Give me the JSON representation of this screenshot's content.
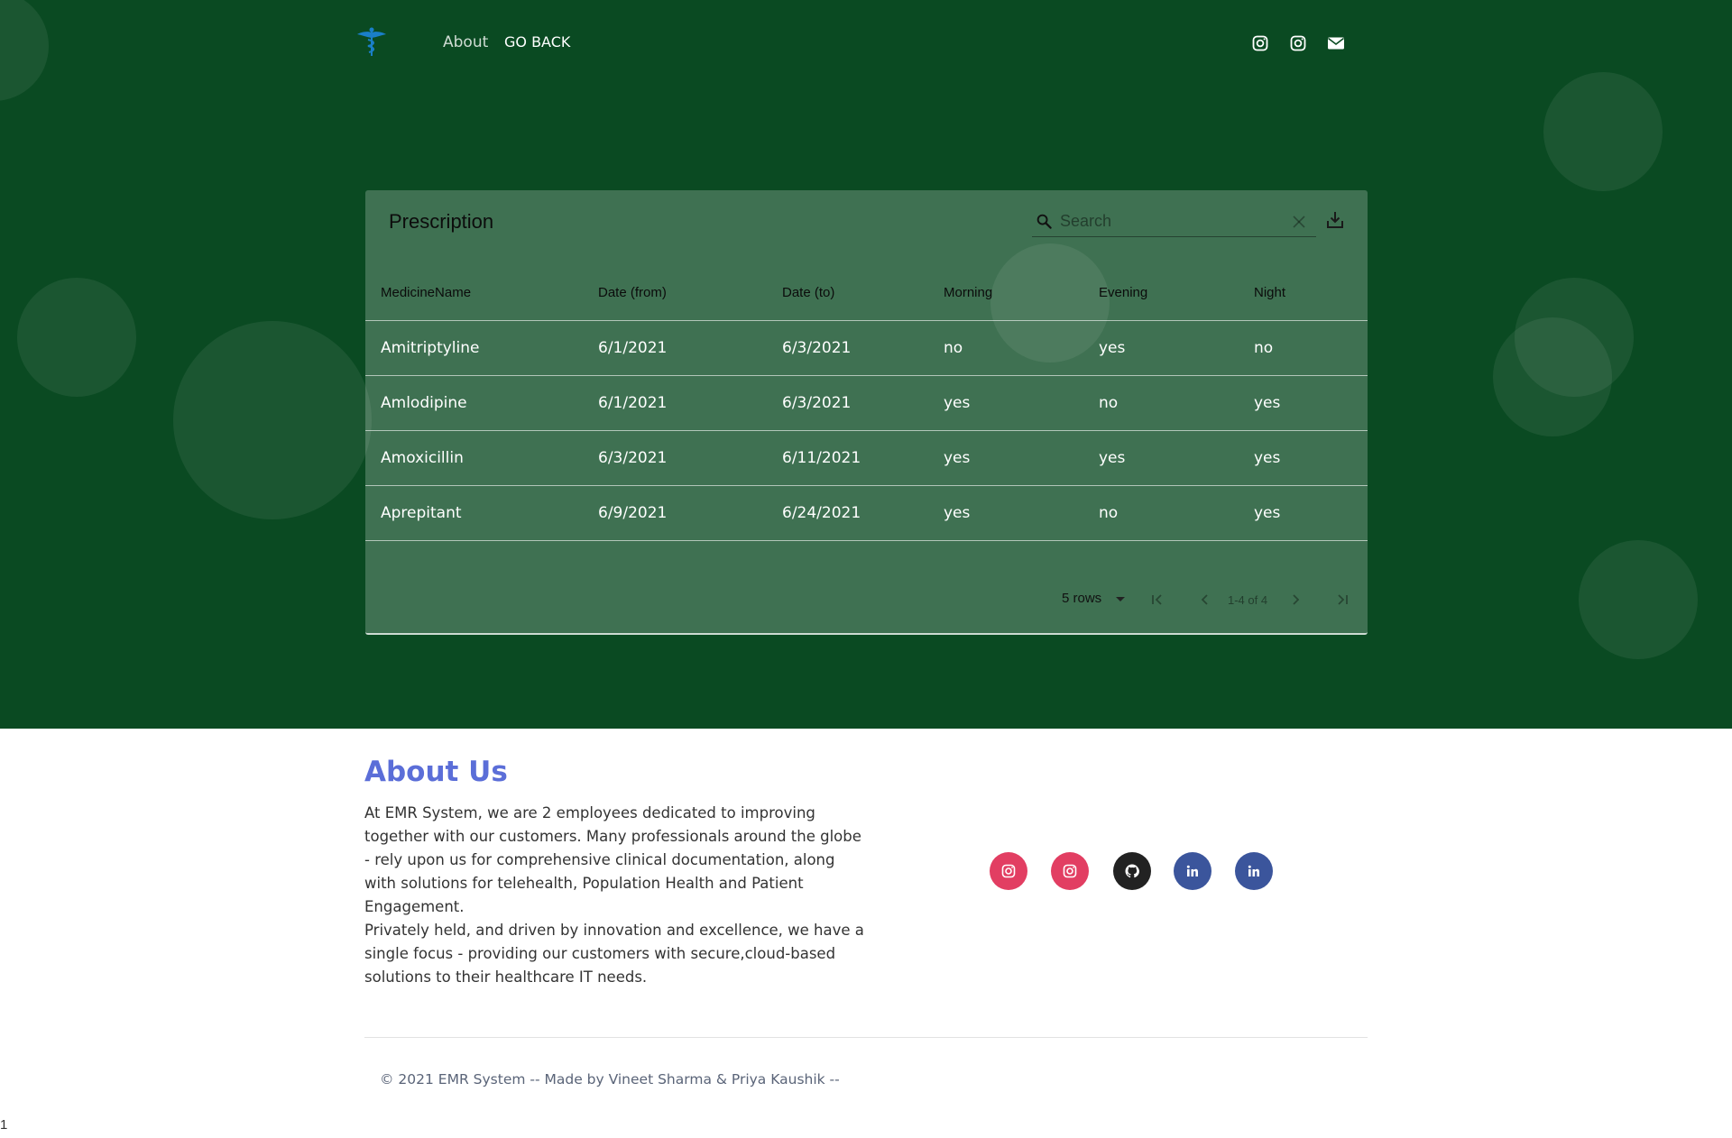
{
  "nav": {
    "about_label": "About",
    "go_back_label": "GO BACK",
    "icons": [
      "instagram-icon",
      "instagram-icon",
      "envelope-icon"
    ]
  },
  "table": {
    "title": "Prescription",
    "search_placeholder": "Search",
    "columns": [
      "MedicineName",
      "Date (from)",
      "Date (to)",
      "Morning",
      "Evening",
      "Night"
    ],
    "rows": [
      [
        "Amitriptyline",
        "6/1/2021",
        "6/3/2021",
        "no",
        "yes",
        "no"
      ],
      [
        "Amlodipine",
        "6/1/2021",
        "6/3/2021",
        "yes",
        "no",
        "yes"
      ],
      [
        "Amoxicillin",
        "6/3/2021",
        "6/11/2021",
        "yes",
        "yes",
        "yes"
      ],
      [
        "Aprepitant",
        "6/9/2021",
        "6/24/2021",
        "yes",
        "no",
        "yes"
      ]
    ],
    "pagination": {
      "rows_per_page": "5 rows",
      "range": "1-4 of 4"
    }
  },
  "about": {
    "title": "About Us",
    "paragraph1": "At EMR System, we are 2 employees dedicated to improving together with our customers. Many professionals around the globe - rely upon us for comprehensive clinical documentation, along with solutions for telehealth, Population Health and Patient Engagement.",
    "paragraph2": "Privately held, and driven by innovation and excellence, we have a single focus - providing our customers with secure,cloud-based solutions to their healthcare IT needs.",
    "social_icons": [
      "instagram-icon",
      "instagram-icon",
      "github-icon",
      "linkedin-icon",
      "linkedin-icon"
    ]
  },
  "footer": {
    "text": "© 2021 EMR System -- Made by Vineet Sharma & Priya Kaushik --",
    "page_number": "1"
  },
  "colors": {
    "hero_bg": "#0a4a22",
    "about_title": "#5b6ed8",
    "instagram": "#e23e62",
    "github": "#222222",
    "linkedin": "#3b559c"
  }
}
